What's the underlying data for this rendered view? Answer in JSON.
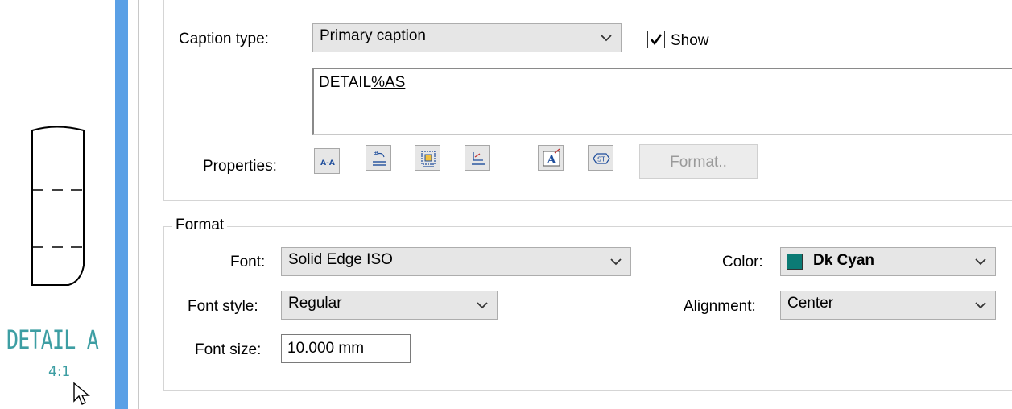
{
  "drawing": {
    "detail_label": "DETAIL A",
    "scale_label": "4:1",
    "annotation_color": "#3d9ea3"
  },
  "caption_group": {
    "caption_type_label": "Caption type:",
    "caption_type_value": "Primary caption",
    "show_label": "Show",
    "show_checked": true,
    "caption_text_static": "DETAIL",
    "caption_text_token": "%AS",
    "properties_label": "Properties:",
    "format_button_label": "Format..",
    "property_icons": [
      "label-icon",
      "numbering-icon",
      "frame-icon",
      "dimension-icon",
      "text-font-icon",
      "symbol-icon"
    ]
  },
  "format_group": {
    "title": "Format",
    "font_label": "Font:",
    "font_value": "Solid Edge ISO",
    "font_style_label": "Font style:",
    "font_style_value": "Regular",
    "font_size_label": "Font size:",
    "font_size_value": "10.000 mm",
    "color_label": "Color:",
    "color_value": "Dk Cyan",
    "color_swatch": "#0b7b75",
    "alignment_label": "Alignment:",
    "alignment_value": "Center"
  }
}
